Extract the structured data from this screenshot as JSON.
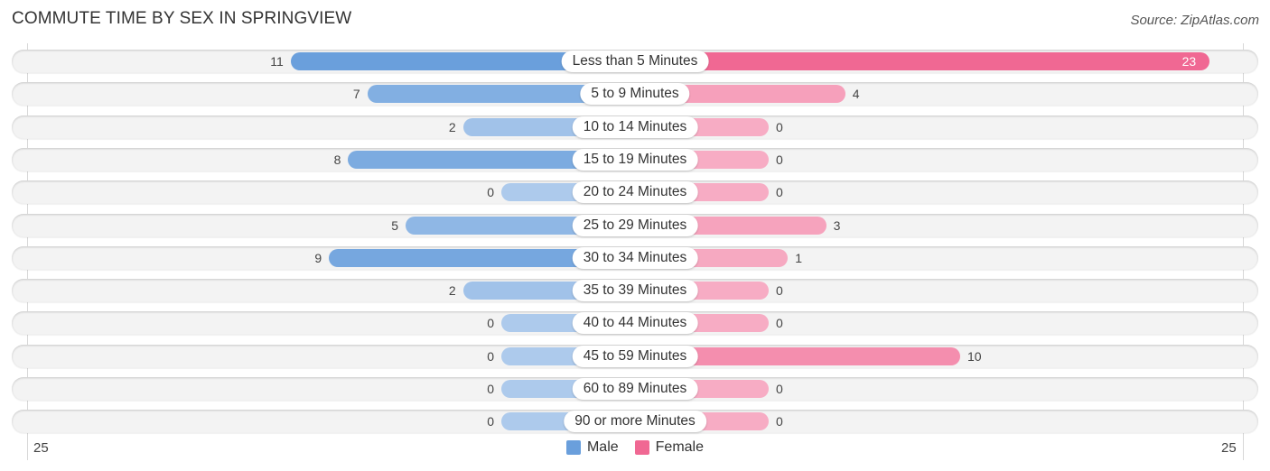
{
  "chart_data": {
    "type": "bar",
    "orientation": "horizontal-diverging",
    "title": "COMMUTE TIME BY SEX IN SPRINGVIEW",
    "source": "Source: ZipAtlas.com",
    "categories": [
      "Less than 5 Minutes",
      "5 to 9 Minutes",
      "10 to 14 Minutes",
      "15 to 19 Minutes",
      "20 to 24 Minutes",
      "25 to 29 Minutes",
      "30 to 34 Minutes",
      "35 to 39 Minutes",
      "40 to 44 Minutes",
      "45 to 59 Minutes",
      "60 to 89 Minutes",
      "90 or more Minutes"
    ],
    "series": [
      {
        "name": "Male",
        "color": "#6a9fdc",
        "values": [
          11,
          7,
          2,
          8,
          0,
          5,
          9,
          2,
          0,
          0,
          0,
          0
        ]
      },
      {
        "name": "Female",
        "color": "#f06893",
        "values": [
          23,
          4,
          0,
          0,
          0,
          3,
          1,
          0,
          0,
          10,
          0,
          0
        ]
      }
    ],
    "axis": {
      "left_tick": "25",
      "right_tick": "25",
      "max": 25
    },
    "legend": {
      "position": "bottom-center",
      "items": [
        {
          "label": "Male",
          "color": "#6a9fdc"
        },
        {
          "label": "Female",
          "color": "#f06893"
        }
      ]
    },
    "grid": false
  }
}
